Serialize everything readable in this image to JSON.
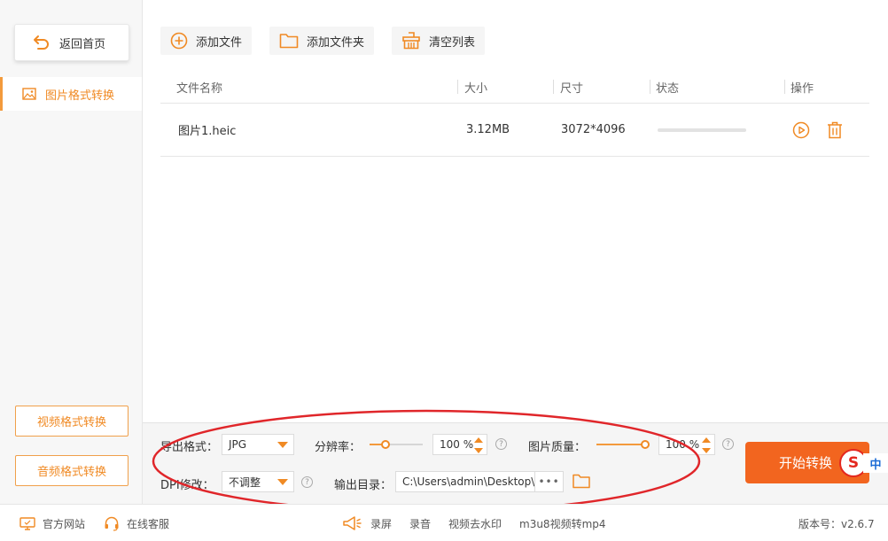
{
  "sidebar": {
    "home_label": "返回首页",
    "active_item_label": "图片格式转换",
    "video_label": "视频格式转换",
    "audio_label": "音频格式转换"
  },
  "toolbar": {
    "add_file_label": "添加文件",
    "add_folder_label": "添加文件夹",
    "clear_list_label": "清空列表"
  },
  "table": {
    "headers": [
      "文件名称",
      "大小",
      "尺寸",
      "状态",
      "操作"
    ],
    "rows": [
      {
        "name": "图片1.heic",
        "size": "3.12MB",
        "dimensions": "3072*4096",
        "progress": 0
      }
    ]
  },
  "settings": {
    "format_label": "导出格式：",
    "format_value": "JPG",
    "resolution_label": "分辨率：",
    "resolution_value": "100 %",
    "resolution_level": 0.3,
    "quality_label": "图片质量：",
    "quality_value": "100 %",
    "quality_level": 1.0,
    "dpi_label": "DPI修改：",
    "dpi_value": "不调整",
    "output_label": "输出目录：",
    "output_path": "C:\\Users\\admin\\Desktop\\",
    "more_label": "•••",
    "help_glyph": "?",
    "start_label": "开始转换"
  },
  "ime": {
    "logo": "S",
    "mode": "中"
  },
  "footer": {
    "website_label": "官方网站",
    "service_label": "在线客服",
    "links": [
      "录屏",
      "录音",
      "视频去水印",
      "m3u8视频转mp4"
    ],
    "version": "版本号：v2.6.7"
  },
  "colors": {
    "accent": "#f08a24",
    "start_button": "#f2651f",
    "annotation": "#e0262a"
  }
}
